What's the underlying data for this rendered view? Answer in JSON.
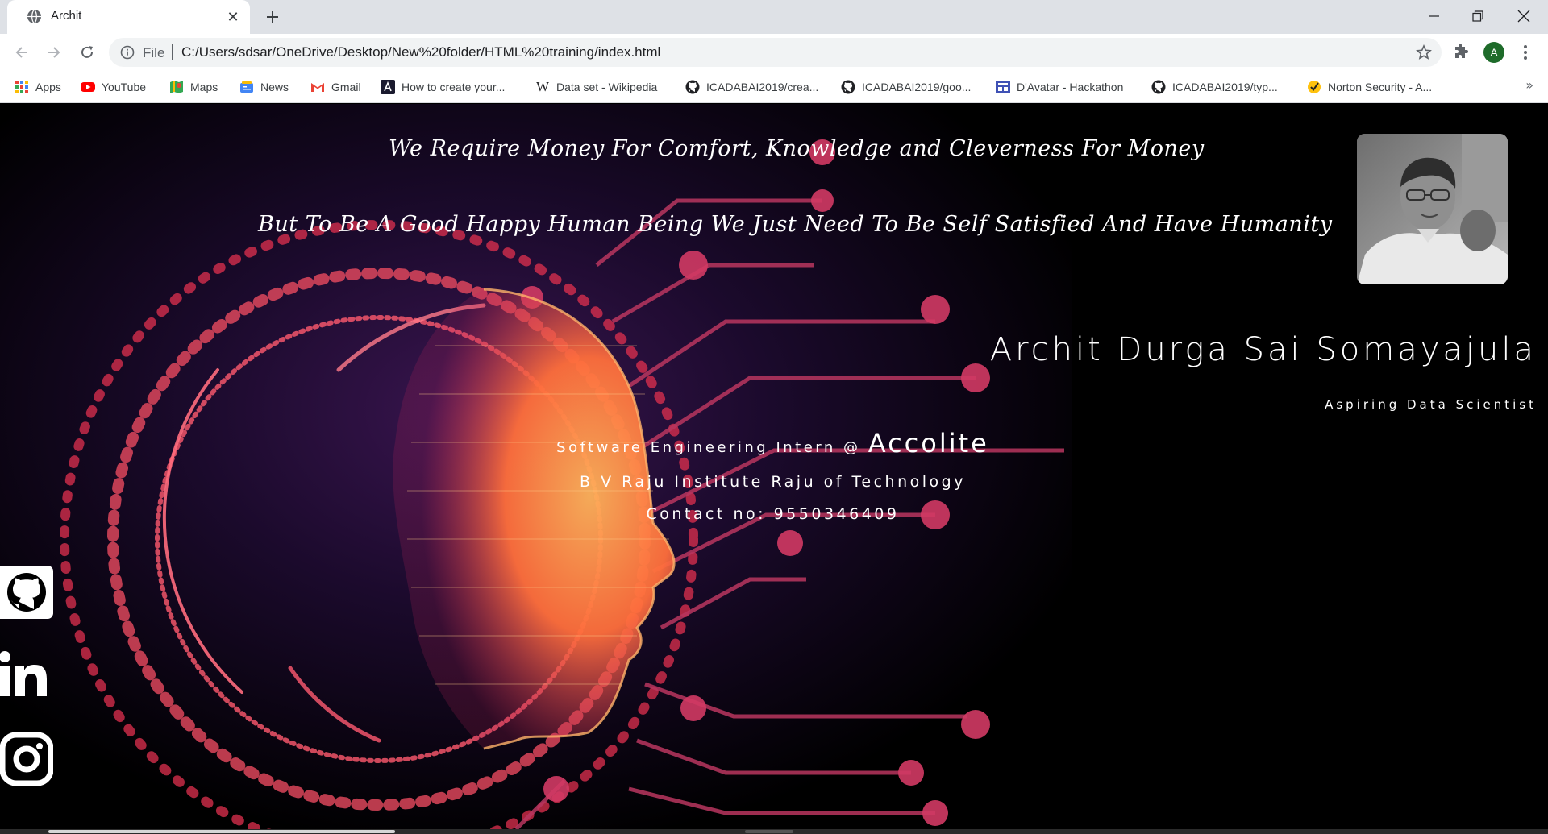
{
  "browser": {
    "tab": {
      "title": "Archit",
      "close_glyph": "✕"
    },
    "new_tab_glyph": "+",
    "omnibox": {
      "scheme_label": "File",
      "url": "C:/Users/sdsar/OneDrive/Desktop/New%20folder/HTML%20training/index.html"
    },
    "profile_initial": "A",
    "bookmarks": [
      {
        "label": "Apps",
        "icon": "apps-grid-icon"
      },
      {
        "label": "YouTube",
        "icon": "youtube-icon"
      },
      {
        "label": "Maps",
        "icon": "maps-icon"
      },
      {
        "label": "News",
        "icon": "news-icon"
      },
      {
        "label": "Gmail",
        "icon": "gmail-icon"
      },
      {
        "label": "How to create your...",
        "icon": "a-logo-icon"
      },
      {
        "label": "Data set - Wikipedia",
        "icon": "wikipedia-icon"
      },
      {
        "label": "ICADABAI2019/crea...",
        "icon": "github-icon"
      },
      {
        "label": "ICADABAI2019/goo...",
        "icon": "github-icon"
      },
      {
        "label": "D'Avatar - Hackathon",
        "icon": "devpost-icon"
      },
      {
        "label": "ICADABAI2019/typ...",
        "icon": "github-icon"
      },
      {
        "label": "Norton Security - A...",
        "icon": "norton-icon"
      }
    ],
    "bookmarks_overflow": "»"
  },
  "page": {
    "quote_line1": "We Require Money For Comfort, Knowledge and Cleverness For Money",
    "quote_line2": "But To Be A Good Happy Human Being We Just Need To Be Self Satisfied And Have Humanity",
    "name": "Archit Durga Sai Somayajula",
    "tagline": "Aspiring Data Scientist",
    "job_title": "Software Engineering Intern @ ",
    "company": "Accolite",
    "college": "B V Raju Institute Raju of Technology",
    "contact": "Contact no: 9550346409",
    "social": [
      "github-icon",
      "linkedin-icon",
      "instagram-icon"
    ]
  },
  "colors": {
    "page_bg": "#000000",
    "accent_glow": "#ff7a45",
    "circuit": "#d8426c"
  }
}
